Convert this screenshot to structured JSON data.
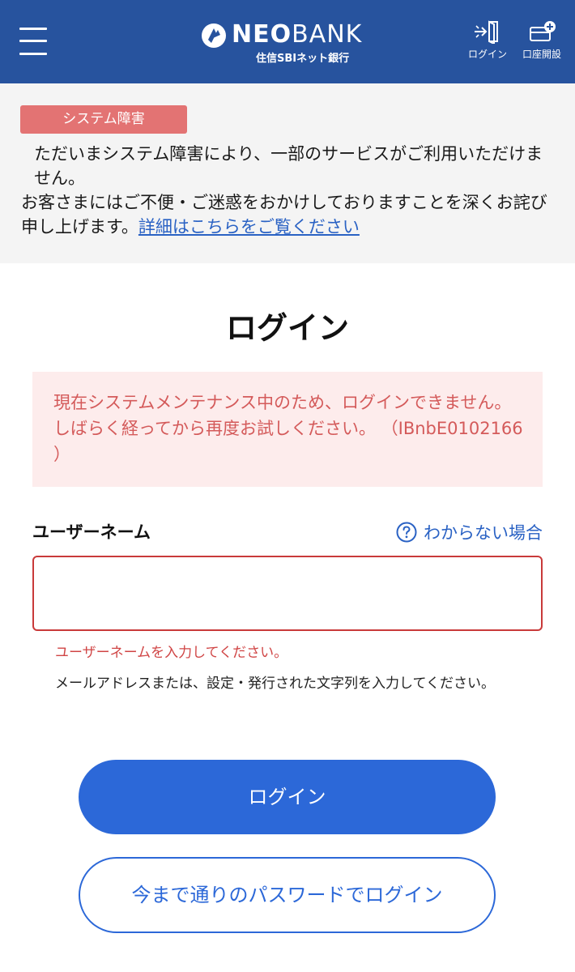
{
  "header": {
    "logo_neo": "NEO",
    "logo_bank": "BANK",
    "logo_sub": "住信SBIネット銀行",
    "login_label": "ログイン",
    "open_account_label": "口座開設",
    "menu_icon": "hamburger-menu-icon",
    "login_icon": "login-door-icon",
    "open_account_icon": "card-plus-icon",
    "brand_color": "#27539e"
  },
  "notice": {
    "badge": "システム障害",
    "line1": "ただいまシステム障害により、一部のサービスがご利用いただけません。",
    "line2": "お客さまにはご不便・ご迷惑をおかけしておりますことを深くお詫び申し上げます。",
    "link": "詳細はこちらをご覧ください",
    "badge_color": "#e37373"
  },
  "main": {
    "title": "ログイン",
    "error_message": "現在システムメンテナンス中のため、ログインできません。しばらく経ってから再度お試しください。 （IBnbE0102166 ）",
    "username_label": "ユーザーネーム",
    "help_link": "わからない場合",
    "help_icon": "question-circle-icon",
    "username_value": "",
    "username_error": "ユーザーネームを入力してください。",
    "username_hint": "メールアドレスまたは、設定・発行された文字列を入力してください。",
    "login_button": "ログイン",
    "password_login_button": "今まで通りのパスワードでログイン",
    "accent_color": "#2c68d8",
    "error_color": "#d04545"
  }
}
